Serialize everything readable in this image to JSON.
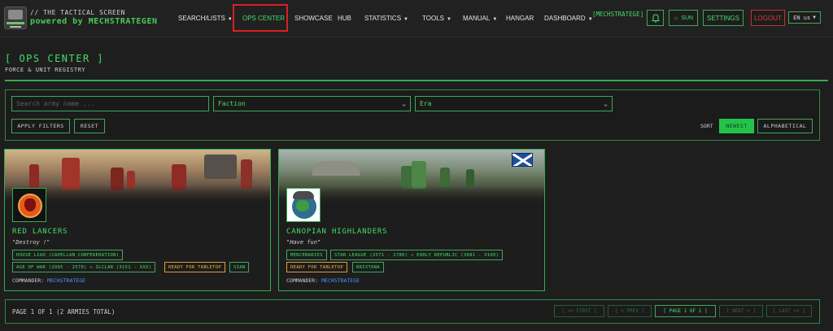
{
  "brand": {
    "tagline": "// THE TACTICAL SCREEN",
    "powered": "powered by MECHSTRATEGEN"
  },
  "nav": {
    "items": [
      {
        "label": "SEARCH/LISTS",
        "has_dropdown": true
      },
      {
        "label": "OPS CENTER",
        "has_dropdown": false,
        "active": true
      },
      {
        "label": "SHOWCASE",
        "has_dropdown": false
      },
      {
        "label": "HUB",
        "has_dropdown": false
      },
      {
        "label": "STATISTICS",
        "has_dropdown": true
      },
      {
        "label": "TOOLS",
        "has_dropdown": true
      },
      {
        "label": "MANUAL",
        "has_dropdown": true
      },
      {
        "label": "HANGAR",
        "has_dropdown": false
      },
      {
        "label": "DASHBOARD",
        "has_dropdown": true
      }
    ],
    "user": "[MECHSTRATEGE]",
    "bell_icon": "bell-icon",
    "theme_label": "SUN",
    "theme_icon": "sun-icon",
    "settings_label": "SETTINGS",
    "logout_label": "LOGOUT",
    "language": "EN us",
    "highlight_color": "#d62222"
  },
  "page": {
    "title": "[ OPS CENTER ]",
    "subtitle": "FORCE & UNIT REGISTRY"
  },
  "filters": {
    "search_placeholder": "Search army name ...",
    "faction_label": "Faction",
    "era_label": "Era",
    "apply_label": "APPLY FILTERS",
    "reset_label": "RESET",
    "sort_label": "SORT",
    "sort_options": [
      "NEWEST",
      "ALPHABETICAL"
    ],
    "sort_selected": "NEWEST"
  },
  "armies": [
    {
      "name": "RED LANCERS",
      "motto": "\"Destroy !\"",
      "emblem_icon": "red-lancers-emblem",
      "tags": [
        "HOUSE LIAO (CAPELLAN CONFEDERATION)",
        "AGE OF WAR (2005 - 2570) → ILCLAN (3151 - XXX)",
        "READY FOR TABLETOP",
        "SIAN"
      ],
      "commander_label": "COMMANDER:",
      "commander": "MECHSTRATEGE"
    },
    {
      "name": "CANOPIAN HIGHLANDERS",
      "motto": "\"Have fun\"",
      "emblem_icon": "canopian-highlanders-emblem",
      "tags": [
        "MERCENARIES",
        "STAR LEAGUE (2571 - 2780) → EARLY REPUBLIC (3081 - 3100)",
        "READY FOR TABLETOP",
        "BRIXTANA"
      ],
      "commander_label": "COMMANDER:",
      "commander": "MECHSTRATEGE"
    }
  ],
  "pagination": {
    "info": "PAGE 1 OF 1 (2 ARMIES TOTAL)",
    "first": "[ << FIRST ]",
    "prev": "[ < PREV ]",
    "current": "[ PAGE 1 OF 1 ]",
    "next": "[ NEXT > ]",
    "last": "[ LAST >> ]"
  },
  "colors": {
    "accent": "#44dd66",
    "background": "#1e1e1e",
    "ready_tag": "#f0b24c",
    "logout": "#e03c3c",
    "link": "#4f93ff"
  }
}
